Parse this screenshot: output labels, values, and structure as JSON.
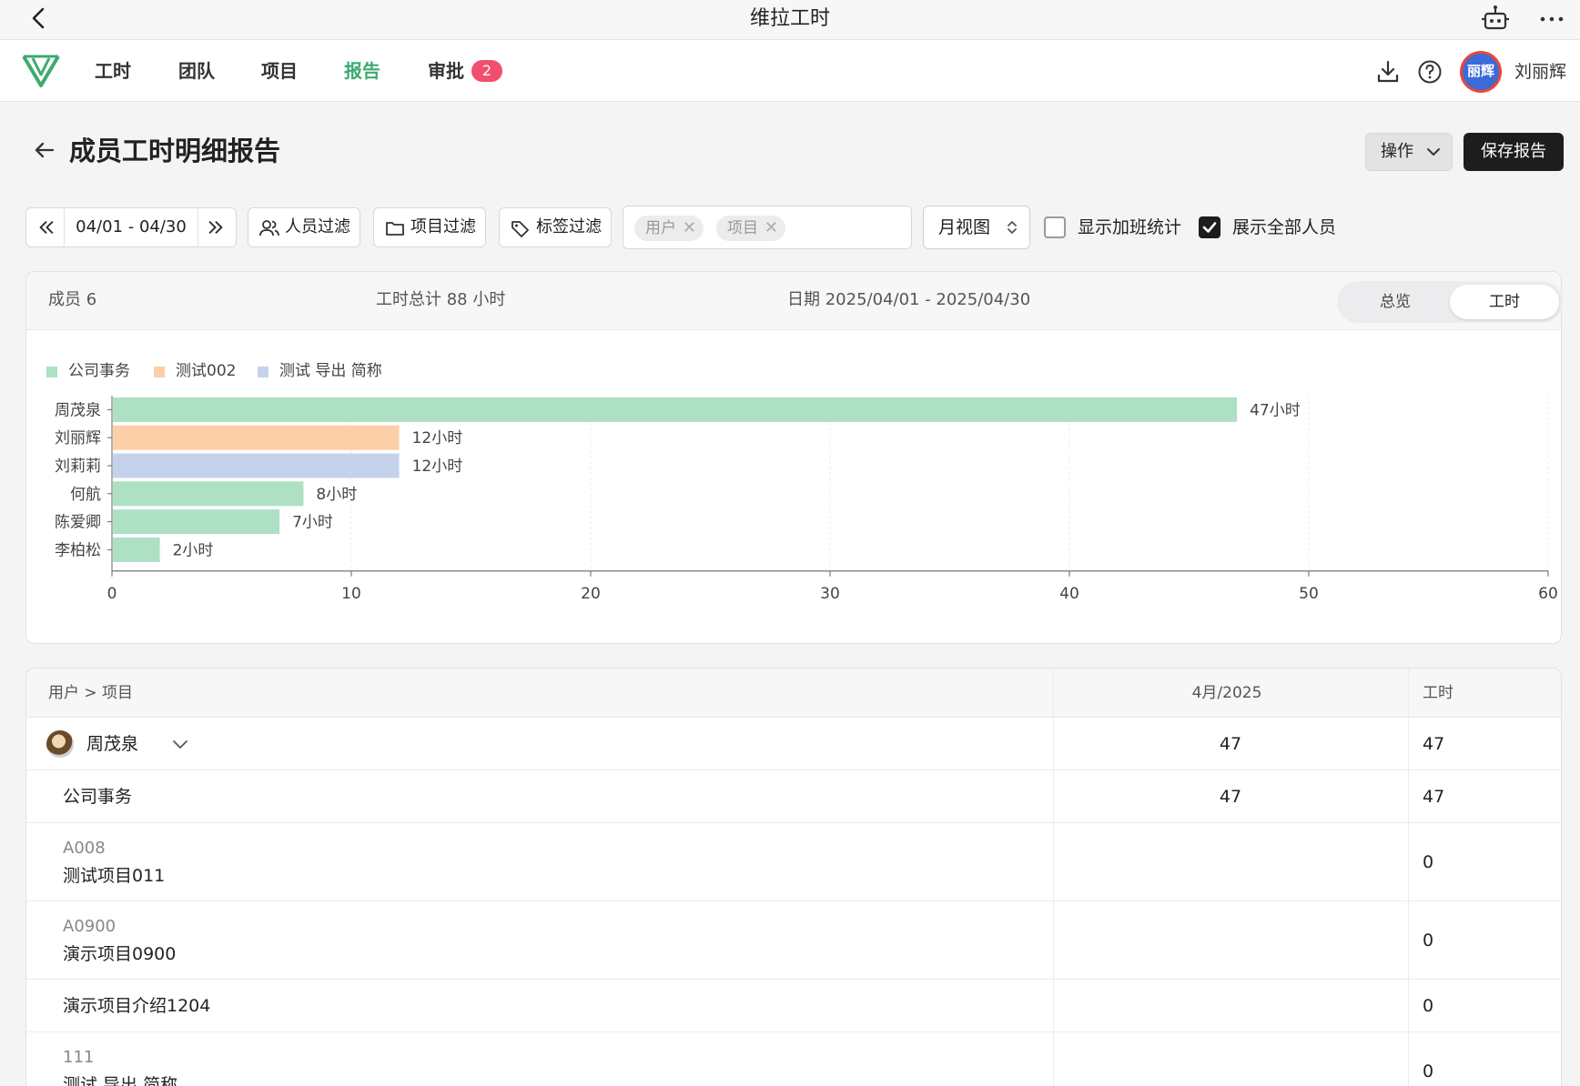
{
  "titlebar": {
    "title": "维拉工时"
  },
  "nav": {
    "items": [
      "工时",
      "团队",
      "项目",
      "报告",
      "审批"
    ],
    "active": "报告",
    "approval_badge": "2",
    "user_name": "刘丽辉",
    "avatar_text": "丽辉"
  },
  "page": {
    "title": "成员工时明细报告",
    "ops_label": "操作",
    "save_label": "保存报告"
  },
  "filters": {
    "date_range": "04/01 - 04/30",
    "people_filter": "人员过滤",
    "project_filter": "项目过滤",
    "tag_filter": "标签过滤",
    "group_chips": [
      "用户",
      "项目"
    ],
    "view_mode": "月视图",
    "show_overtime_label": "显示加班统计",
    "show_overtime": false,
    "show_all_label": "展示全部人员",
    "show_all": true
  },
  "summary": {
    "members": "成员 6",
    "total_hours": "工时总计 88 小时",
    "date_range": "日期 2025/04/01 - 2025/04/30",
    "tab_overview": "总览",
    "tab_hours": "工时",
    "active_tab": "工时"
  },
  "chart_data": {
    "type": "bar",
    "orientation": "horizontal",
    "categories": [
      "周茂泉",
      "刘丽辉",
      "刘莉莉",
      "何航",
      "陈爱卿",
      "李柏松"
    ],
    "values": [
      47,
      12,
      12,
      8,
      7,
      2
    ],
    "value_labels": [
      "47小时",
      "12小时",
      "12小时",
      "8小时",
      "7小时",
      "2小时"
    ],
    "series_legend": [
      {
        "name": "公司事务",
        "color": "#aee0c4"
      },
      {
        "name": "测试002",
        "color": "#fbcfa8"
      },
      {
        "name": "测试 导出 简称",
        "color": "#c5d2eb"
      }
    ],
    "bar_colors": [
      "#aee0c4",
      "#fbcfa8",
      "#c5d2eb",
      "#aee0c4",
      "#aee0c4",
      "#aee0c4"
    ],
    "xlim": [
      0,
      60
    ],
    "xticks": [
      0,
      10,
      20,
      30,
      40,
      50,
      60
    ],
    "grid": true
  },
  "table": {
    "headers": [
      "用户 > 项目",
      "4月/2025",
      "工时"
    ],
    "rows": [
      {
        "kind": "user",
        "name": "周茂泉",
        "month": "47",
        "hours": "47"
      },
      {
        "kind": "project",
        "name": "公司事务",
        "month": "47",
        "hours": "47"
      },
      {
        "kind": "project",
        "code": "A008",
        "name": "测试项目011",
        "month": "",
        "hours": "0"
      },
      {
        "kind": "project",
        "code": "A0900",
        "name": "演示项目0900",
        "month": "",
        "hours": "0"
      },
      {
        "kind": "project",
        "name": "演示项目介绍1204",
        "month": "",
        "hours": "0"
      },
      {
        "kind": "project",
        "code": "111",
        "name": "测试 导出 简称",
        "month": "",
        "hours": "0"
      }
    ]
  }
}
